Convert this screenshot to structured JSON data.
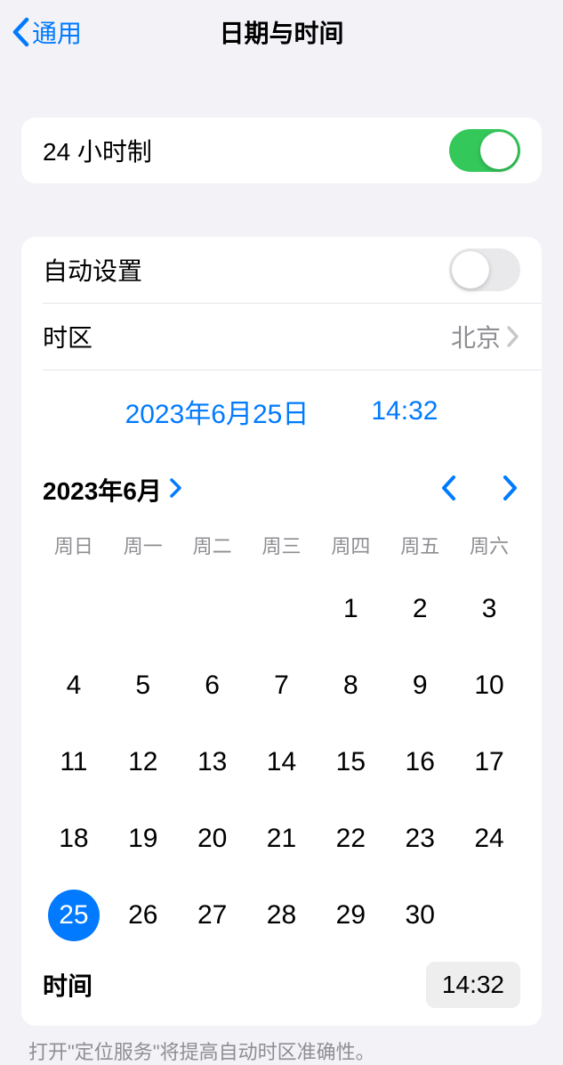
{
  "nav": {
    "back_label": "通用",
    "title": "日期与时间"
  },
  "section1": {
    "hour24_label": "24 小时制",
    "hour24_on": true
  },
  "section2": {
    "auto_set_label": "自动设置",
    "auto_set_on": false,
    "timezone_label": "时区",
    "timezone_value": "北京",
    "date_display": "2023年6月25日",
    "time_display": "14:32",
    "month_label": "2023年6月",
    "weekdays": [
      "周日",
      "周一",
      "周二",
      "周三",
      "周四",
      "周五",
      "周六"
    ],
    "calendar": {
      "leading_empty": 4,
      "days": 30,
      "selected": 25
    },
    "time_row_label": "时间",
    "time_row_value": "14:32"
  },
  "footer": "打开\"定位服务\"将提高自动时区准确性。"
}
